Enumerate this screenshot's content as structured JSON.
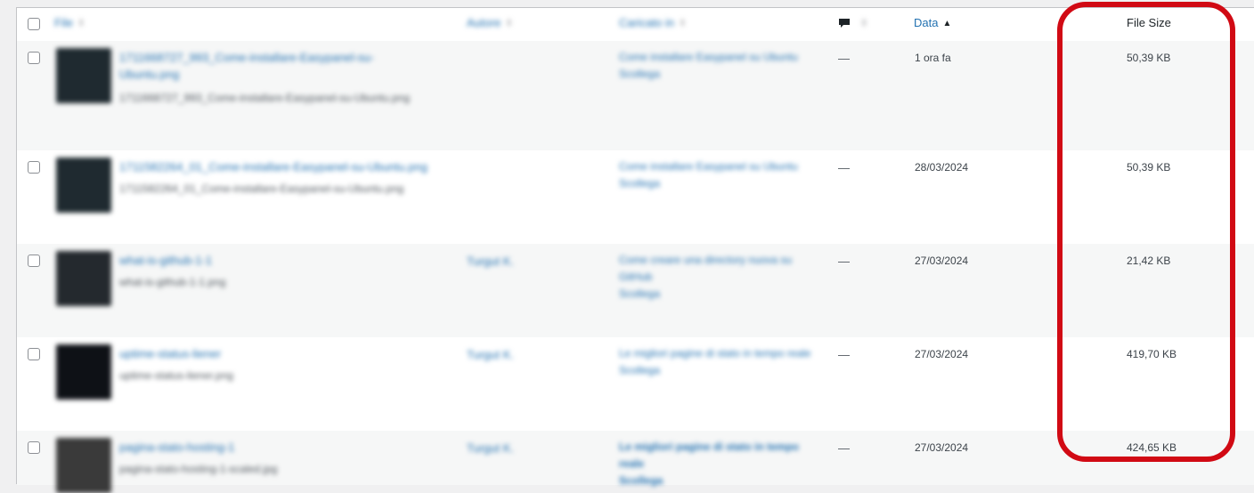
{
  "header": {
    "file": "File",
    "author": "Autore",
    "attached": "Caricato in",
    "date": "Data",
    "file_size": "File Size"
  },
  "rows": [
    {
      "title": "1711668727_993_Come-installare-Easypanel-su-Ubuntu.png",
      "filename": "1711668727_993_Come-installare-Easypanel-su-Ubuntu.png",
      "author": "",
      "attached_to": "Come installare Easypanel su Ubuntu",
      "detach": "Scollega",
      "comments": "—",
      "date": "1 ora fa",
      "size": "50,39 KB"
    },
    {
      "title": "1711582264_01_Come-installare-Easypanel-su-Ubuntu.png",
      "filename": "1711582264_01_Come-installare-Easypanel-su-Ubuntu.png",
      "author": "",
      "attached_to": "Come installare Easypanel su Ubuntu",
      "detach": "Scollega",
      "comments": "—",
      "date": "28/03/2024",
      "size": "50,39 KB"
    },
    {
      "title": "what-is-github-1-1",
      "filename": "what-is-github-1-1.png",
      "author": "Turgut K.",
      "attached_to": "Come creare una directory nuova su GitHub",
      "detach": "Scollega",
      "comments": "—",
      "date": "27/03/2024",
      "size": "21,42 KB"
    },
    {
      "title": "uptime-status-liener",
      "filename": "uptime-status-liener.png",
      "author": "Turgut K.",
      "attached_to": "Le migliori pagine di stato in tempo reale",
      "detach": "Scollega",
      "comments": "—",
      "date": "27/03/2024",
      "size": "419,70 KB"
    },
    {
      "title": "pagina-stato-hosting-1",
      "filename": "pagina-stato-hosting-1-scaled.jpg",
      "author": "Turgut K.",
      "attached_to": "Le migliori pagine di stato in tempo reale",
      "detach": "Scollega",
      "comments": "—",
      "date": "27/03/2024",
      "size": "424,65 KB"
    }
  ],
  "colors": {
    "link": "#2271b1",
    "highlight": "#d10a14",
    "alt_row": "#f6f7f7"
  }
}
